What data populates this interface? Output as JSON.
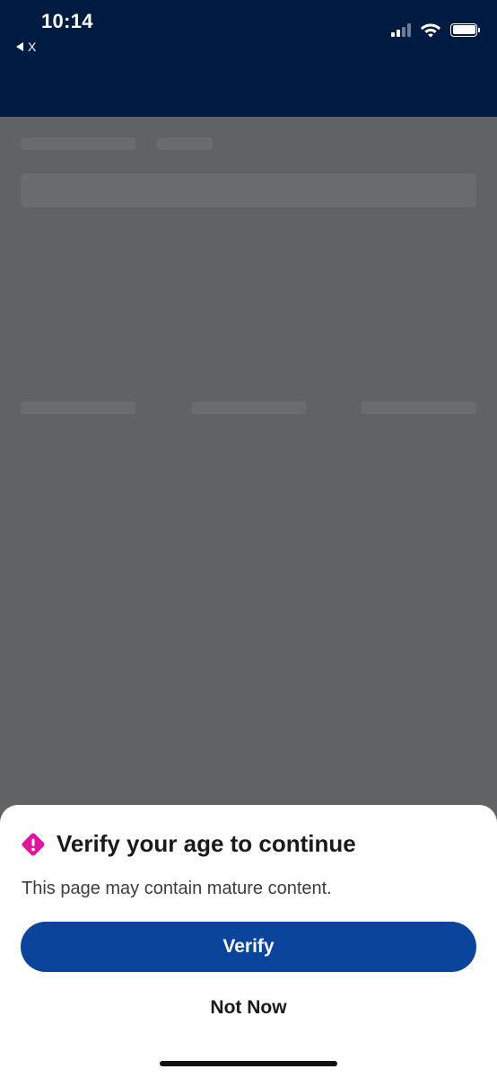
{
  "status_bar": {
    "time": "10:14",
    "back_app_label": "X"
  },
  "icons": {
    "signal": "cellular-signal-icon",
    "wifi": "wifi-icon",
    "battery": "battery-icon",
    "alert": "alert-diamond-icon",
    "back": "back-triangle-icon"
  },
  "colors": {
    "header_bg": "#001b42",
    "overlay_bg": "#616264",
    "primary_button": "#0b449b",
    "alert_icon": "#e0179a"
  },
  "age_gate": {
    "title": "Verify your age to continue",
    "message": "This page may contain mature content.",
    "verify_label": "Verify",
    "not_now_label": "Not Now"
  }
}
